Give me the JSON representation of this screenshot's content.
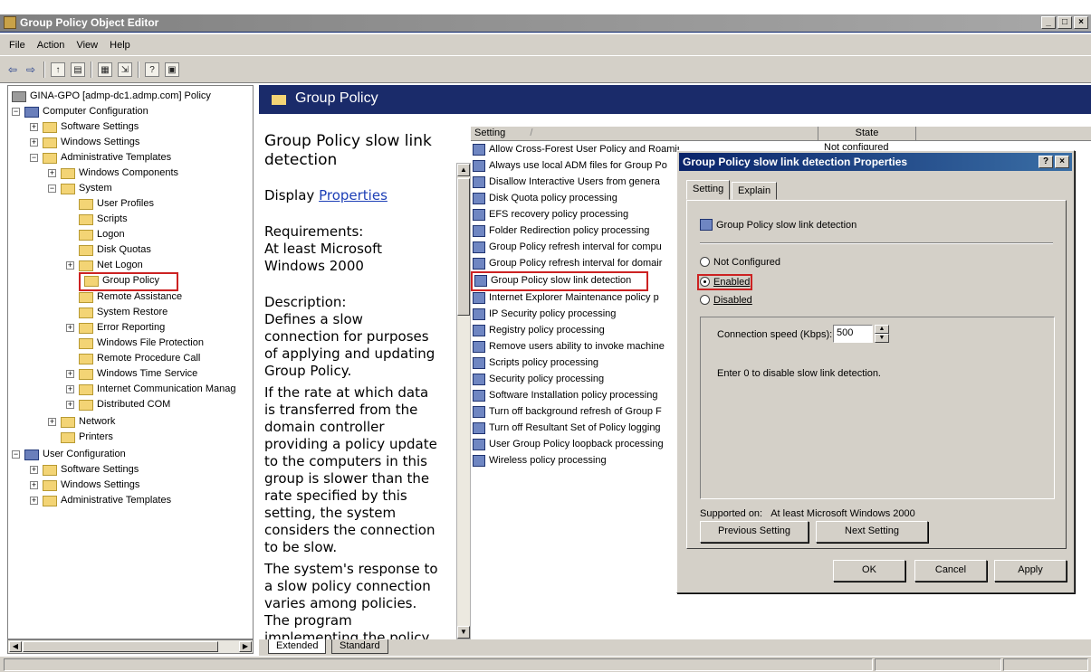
{
  "window": {
    "title": "Group Policy Object Editor",
    "controls": [
      "_",
      "□",
      "×"
    ]
  },
  "menu": {
    "file": "File",
    "action": "Action",
    "view": "View",
    "help": "Help"
  },
  "toolbar": {
    "icons": [
      "back-icon",
      "forward-icon",
      "up-level-icon",
      "show-hide-tree-icon",
      "properties-icon",
      "export-icon",
      "help-icon",
      "console-icon"
    ]
  },
  "tree": {
    "root": "GINA-GPO [admp-dc1.admp.com] Policy",
    "computer_config": "Computer Configuration",
    "software_settings": "Software Settings",
    "windows_settings": "Windows Settings",
    "admin_templates": "Administrative Templates",
    "windows_components": "Windows Components",
    "system": "System",
    "user_profiles": "User Profiles",
    "scripts": "Scripts",
    "logon": "Logon",
    "disk_quotas": "Disk Quotas",
    "net_logon": "Net Logon",
    "group_policy": "Group Policy",
    "remote_assistance": "Remote Assistance",
    "system_restore": "System Restore",
    "error_reporting": "Error Reporting",
    "windows_file_protection": "Windows File Protection",
    "remote_procedure_call": "Remote Procedure Call",
    "windows_time_service": "Windows Time Service",
    "internet_comm": "Internet Communication Manag",
    "distributed_com": "Distributed COM",
    "network": "Network",
    "printers": "Printers",
    "user_config": "User Configuration",
    "user_software_settings": "Software Settings",
    "user_windows_settings": "Windows Settings",
    "user_admin_templates": "Administrative Templates"
  },
  "header": {
    "title": "Group Policy"
  },
  "description": {
    "title": "Group Policy slow link detection",
    "display": "Display",
    "properties_link": "Properties",
    "requirements_label": "Requirements:",
    "requirements_value": "At least Microsoft Windows 2000",
    "description_label": "Description:",
    "p1": "Defines a slow connection for purposes of applying and updating Group Policy.",
    "p2": "If the rate at which data is transferred from the domain controller providing a policy update to the computers in this group is slower than the rate specified by this setting, the system considers the connection to be slow.",
    "p3": "The system's response to a slow policy connection varies among policies. The program implementing the policy can specify the"
  },
  "list": {
    "col_setting": "Setting",
    "col_state": "State",
    "sort_indicator": "/",
    "state_first": "Not configured",
    "rows": [
      "Allow Cross-Forest User Policy and Roaming User Profiles",
      "Always use local ADM files for Group Po",
      "Disallow Interactive Users from genera",
      "Disk Quota policy processing",
      "EFS recovery policy processing",
      "Folder Redirection policy processing",
      "Group Policy refresh interval for compu",
      "Group Policy refresh interval for domair",
      "Group Policy slow link detection",
      "Internet Explorer Maintenance policy p",
      "IP Security policy processing",
      "Registry policy processing",
      "Remove users ability to invoke machine",
      "Scripts policy processing",
      "Security policy processing",
      "Software Installation policy processing",
      "Turn off background refresh of Group F",
      "Turn off Resultant Set of Policy logging",
      "User Group Policy loopback processing",
      "Wireless policy processing"
    ]
  },
  "tabs": {
    "extended": "Extended",
    "standard": "Standard"
  },
  "dialog": {
    "title": "Group Policy slow link detection Properties",
    "help_btn": "?",
    "close_btn": "×",
    "tab_setting": "Setting",
    "tab_explain": "Explain",
    "setting_name": "Group Policy slow link detection",
    "radio_not_configured": "Not Configured",
    "radio_enabled": "Enabled",
    "radio_disabled": "Disabled",
    "speed_label": "Connection speed (Kbps):",
    "speed_value": "500",
    "hint": "Enter 0 to disable slow link detection.",
    "supported_label": "Supported on:",
    "supported_value": "At least Microsoft Windows 2000",
    "prev_button": "Previous Setting",
    "next_button": "Next Setting",
    "ok_button": "OK",
    "cancel_button": "Cancel",
    "apply_button": "Apply"
  }
}
